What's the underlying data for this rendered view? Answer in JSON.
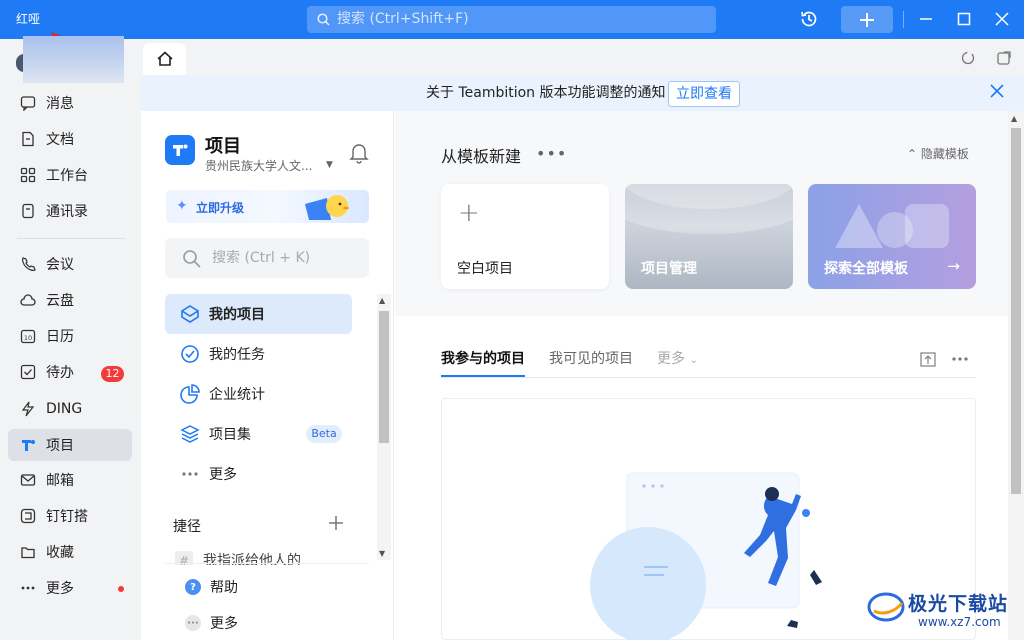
{
  "titlebar": {
    "app_badge": "红哑",
    "search_placeholder": "搜索 (Ctrl+Shift+F)",
    "accent": "#1f7af5"
  },
  "nav": {
    "items": [
      {
        "label": "消息",
        "icon": "message-icon"
      },
      {
        "label": "文档",
        "icon": "document-icon"
      },
      {
        "label": "工作台",
        "icon": "workbench-icon"
      },
      {
        "label": "通讯录",
        "icon": "contacts-icon"
      },
      {
        "label": "会议",
        "icon": "meeting-icon"
      },
      {
        "label": "云盘",
        "icon": "cloud-icon"
      },
      {
        "label": "日历",
        "icon": "calendar-icon"
      },
      {
        "label": "待办",
        "icon": "todo-icon",
        "badge": "12"
      },
      {
        "label": "DING",
        "icon": "ding-icon"
      },
      {
        "label": "项目",
        "icon": "project-icon",
        "active": true
      },
      {
        "label": "邮箱",
        "icon": "mail-icon"
      },
      {
        "label": "钉钉搭",
        "icon": "builder-icon"
      },
      {
        "label": "收藏",
        "icon": "favorites-icon"
      },
      {
        "label": "更多",
        "icon": "more-icon",
        "dot": true
      }
    ]
  },
  "notice": {
    "text": "关于 Teambition 版本功能调整的通知",
    "action": "立即查看"
  },
  "project_panel": {
    "title": "项目",
    "org": "贵州民族大学人文...",
    "upgrade": "立即升级",
    "search_placeholder": "搜索 (Ctrl + K)",
    "items": [
      {
        "label": "我的项目",
        "icon": "my-projects-icon",
        "active": true
      },
      {
        "label": "我的任务",
        "icon": "my-tasks-icon"
      },
      {
        "label": "企业统计",
        "icon": "stats-icon"
      },
      {
        "label": "项目集",
        "icon": "project-set-icon",
        "badge": "Beta"
      },
      {
        "label": "更多",
        "icon": "more-dots-icon"
      }
    ],
    "shortcut_title": "捷径",
    "shortcut_item": "我指派给他人的",
    "bottom": [
      {
        "label": "帮助",
        "icon": "help-icon"
      },
      {
        "label": "更多",
        "icon": "more-circle-icon"
      }
    ]
  },
  "main": {
    "template_title": "从模板新建",
    "hide_templates": "隐藏模板",
    "cards": [
      {
        "label": "空白项目"
      },
      {
        "label": "项目管理"
      },
      {
        "label": "探索全部模板"
      }
    ],
    "tabs": [
      {
        "label": "我参与的项目",
        "active": true
      },
      {
        "label": "我可见的项目"
      },
      {
        "label": "更多"
      }
    ]
  },
  "watermark": {
    "text": "极光下载站",
    "url": "www.xz7.com"
  }
}
